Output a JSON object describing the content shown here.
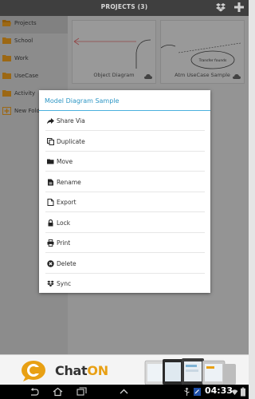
{
  "header": {
    "title": "PROJECTS (3)",
    "icons": [
      "dropbox-icon",
      "add-icon"
    ]
  },
  "sidebar": {
    "items": [
      {
        "label": "Projects",
        "icon": "open-folder-icon",
        "active": true
      },
      {
        "label": "School",
        "icon": "folder-icon"
      },
      {
        "label": "Work",
        "icon": "folder-icon"
      },
      {
        "label": "UseCase",
        "icon": "folder-icon"
      },
      {
        "label": "Activity",
        "icon": "folder-icon"
      },
      {
        "label": "New Folder",
        "icon": "new-folder-icon"
      }
    ]
  },
  "cards": [
    {
      "caption": "Object Diagram",
      "icon": "cloud-icon"
    },
    {
      "caption": "Atm UseCase Sample",
      "icon": "cloud-icon",
      "thumb_label": "Transfer founds"
    }
  ],
  "dialog": {
    "title": "Model Diagram Sample",
    "items": [
      {
        "label": "Share Via",
        "icon": "share-icon"
      },
      {
        "label": "Duplicate",
        "icon": "duplicate-icon"
      },
      {
        "label": "Move",
        "icon": "folder-move-icon"
      },
      {
        "label": "Rename",
        "icon": "rename-icon"
      },
      {
        "label": "Export",
        "icon": "export-icon"
      },
      {
        "label": "Lock",
        "icon": "lock-icon"
      },
      {
        "label": "Print",
        "icon": "print-icon"
      },
      {
        "label": "Delete",
        "icon": "delete-icon"
      },
      {
        "label": "Sync",
        "icon": "dropbox-icon"
      }
    ]
  },
  "ad": {
    "brand_prefix": "Chat",
    "brand_suffix": "ON"
  },
  "system_bar": {
    "time": "04:33"
  },
  "colors": {
    "accent": "#2f97c5",
    "folder": "#f0a020",
    "ad_brand": "#e8a014"
  }
}
